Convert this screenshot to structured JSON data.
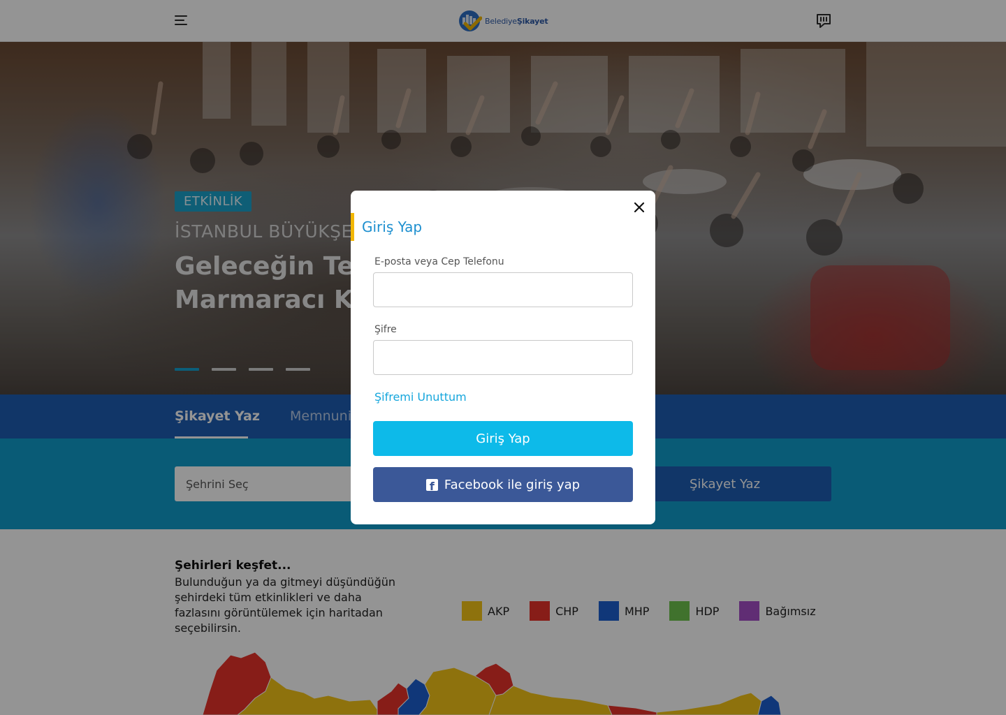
{
  "header": {
    "logo": {
      "prefix": "Belediye",
      "suffix": "Şikayet"
    }
  },
  "hero": {
    "tag": "ETKİNLİK",
    "kicker": "İSTANBUL BÜYÜKŞE",
    "title": "Geleceğin Tekn İBB Marmaracı Kampı’nda",
    "slides_count": 4,
    "active_slide": 1
  },
  "tabs": [
    {
      "label": "Şikayet Yaz",
      "active": true
    },
    {
      "label": "Memnuni",
      "active": false
    }
  ],
  "complaint": {
    "city_placeholder": "Şehrini Seç",
    "submit_label": "Şikayet Yaz"
  },
  "explore": {
    "title": "Şehirleri keşfet...",
    "description": "Bulunduğun ya da gitmeyi düşündüğün şehirdeki tüm etkinlikleri ve daha fazlasını görüntülemek için haritadan seçebilirsin."
  },
  "legend": [
    {
      "label": "AKP",
      "color": "#f5c518"
    },
    {
      "label": "CHP",
      "color": "#e8332a"
    },
    {
      "label": "MHP",
      "color": "#1d5fd1"
    },
    {
      "label": "HDP",
      "color": "#6fc44e"
    },
    {
      "label": "Bağımsız",
      "color": "#a64fc9"
    }
  ],
  "modal": {
    "title": "Giriş Yap",
    "email_label": "E-posta veya Cep Telefonu",
    "email_value": "",
    "password_label": "Şifre",
    "password_value": "",
    "forgot_label": "Şifremi Unuttum",
    "login_label": "Giriş Yap",
    "facebook_label": "Facebook ile giriş yap"
  },
  "colors": {
    "primary_blue": "#1e5eb3",
    "teal": "#109ecc",
    "login_button": "#0dbae9",
    "facebook": "#3b5898",
    "accent_yellow": "#f2b705",
    "link": "#15a6dc"
  }
}
